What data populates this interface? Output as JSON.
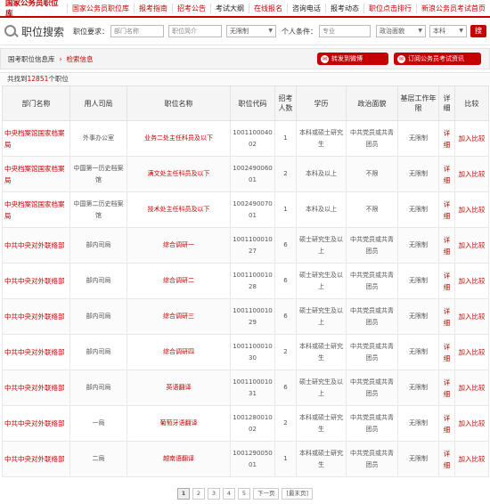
{
  "nav": {
    "brand": "国家公务员职位库",
    "links": [
      {
        "label": "国家公务员职位库",
        "color": "red"
      },
      {
        "label": "报考指南",
        "color": "red"
      },
      {
        "label": "招考公告",
        "color": "red"
      },
      {
        "label": "考试大纲",
        "color": "blk"
      },
      {
        "label": "在线报名",
        "color": "red"
      },
      {
        "label": "咨询电话",
        "color": "blk"
      },
      {
        "label": "报考动态",
        "color": "blk"
      },
      {
        "label": "职位点击排行",
        "color": "red"
      },
      {
        "label": "新浪公务员考试首页",
        "color": "red"
      }
    ]
  },
  "search": {
    "title": "职位搜索",
    "req_label": "职位要求：",
    "dept_placeholder": "部门名称",
    "pos_placeholder": "职位简介",
    "limit_value": "无限制",
    "cond_label": "个人条件：",
    "major_placeholder": "专业",
    "politics_value": "政治面貌",
    "edu_value": "本科",
    "button": "搜"
  },
  "crumb": {
    "home": "国考职位信息库",
    "sep": "›",
    "current": "检索信息"
  },
  "actions": {
    "share": "转发到微博",
    "subscribe": "订阅公务员考试资讯"
  },
  "found": {
    "prefix": "共找到",
    "count": "12851",
    "suffix": "个职位"
  },
  "table": {
    "headers": [
      "部门名称",
      "用人司局",
      "职位名称",
      "职位代码",
      "招考人数",
      "学历",
      "政治面貌",
      "基层工作年限",
      "详细",
      "比较"
    ],
    "detail_label": "详细",
    "compare_label": "加入比较",
    "rows": [
      {
        "dept": "中央档案馆国家档案局",
        "bureau": "外事办公室",
        "position": "业务二处主任科员及以下",
        "code": "100110004002",
        "count": "1",
        "edu": "本科或硕士研究生",
        "politics": "中共党员或共青团员",
        "years": "无限制"
      },
      {
        "dept": "中央档案馆国家档案局",
        "bureau": "中国第一历史档案馆",
        "position": "满文处主任科员及以下",
        "code": "100249006001",
        "count": "2",
        "edu": "本科及以上",
        "politics": "不限",
        "years": "无限制"
      },
      {
        "dept": "中央档案馆国家档案局",
        "bureau": "中国第二历史档案馆",
        "position": "技术处主任科员及以下",
        "code": "100249007001",
        "count": "1",
        "edu": "本科及以上",
        "politics": "不限",
        "years": "无限制"
      },
      {
        "dept": "中共中央对外联络部",
        "bureau": "部内司局",
        "position": "综合调研一",
        "code": "100110001027",
        "count": "6",
        "edu": "硕士研究生及以上",
        "politics": "中共党员或共青团员",
        "years": "无限制"
      },
      {
        "dept": "中共中央对外联络部",
        "bureau": "部内司局",
        "position": "综合调研二",
        "code": "100110001028",
        "count": "6",
        "edu": "硕士研究生及以上",
        "politics": "中共党员或共青团员",
        "years": "无限制"
      },
      {
        "dept": "中共中央对外联络部",
        "bureau": "部内司局",
        "position": "综合调研三",
        "code": "100110001029",
        "count": "6",
        "edu": "硕士研究生及以上",
        "politics": "中共党员或共青团员",
        "years": "无限制"
      },
      {
        "dept": "中共中央对外联络部",
        "bureau": "部内司局",
        "position": "综合调研四",
        "code": "100110001030",
        "count": "2",
        "edu": "本科或硕士研究生",
        "politics": "中共党员或共青团员",
        "years": "无限制"
      },
      {
        "dept": "中共中央对外联络部",
        "bureau": "部内司局",
        "position": "英语翻译",
        "code": "100110001031",
        "count": "6",
        "edu": "硕士研究生及以上",
        "politics": "中共党员或共青团员",
        "years": "无限制"
      },
      {
        "dept": "中共中央对外联络部",
        "bureau": "一局",
        "position": "葡萄牙语翻译",
        "code": "100128001002",
        "count": "2",
        "edu": "本科或硕士研究生",
        "politics": "中共党员或共青团员",
        "years": "无限制"
      },
      {
        "dept": "中共中央对外联络部",
        "bureau": "二局",
        "position": "越南语翻译",
        "code": "100129005001",
        "count": "1",
        "edu": "本科或硕士研究生",
        "politics": "中共党员或共青团员",
        "years": "无限制"
      }
    ]
  },
  "pager": {
    "pages": [
      "1",
      "2",
      "3",
      "4",
      "5"
    ],
    "current": "1",
    "next": "下一页",
    "last": "[最末页]"
  }
}
